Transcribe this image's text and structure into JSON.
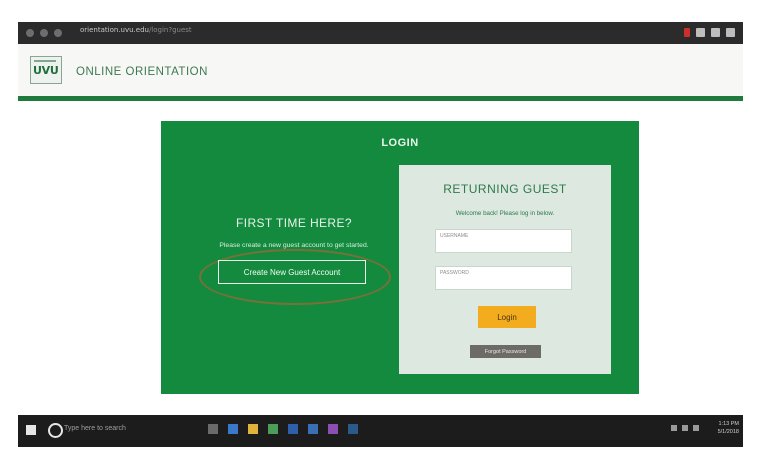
{
  "browser": {
    "url": "orientation.uvu.edu",
    "url_suffix": "/login?guest"
  },
  "header": {
    "logo_text": "UVU",
    "site_title": "ONLINE ORIENTATION"
  },
  "login_panel": {
    "title": "LOGIN",
    "first_time_title": "FIRST TIME HERE?",
    "first_time_desc": "Please create a new guest account to get started.",
    "create_button": "Create New Guest Account",
    "returning_title": "RETURNING GUEST",
    "returning_sub": "Welcome back! Please log in below.",
    "username_placeholder": "USERNAME",
    "password_placeholder": "PASSWORD",
    "login_button": "Login",
    "forgot_button": "Forgot Password"
  },
  "taskbar": {
    "search_placeholder": "Type here to search",
    "time": "1:13 PM",
    "date": "5/1/2018"
  },
  "colors": {
    "brand_green": "#148a3f",
    "login_gold": "#f2ac1d"
  }
}
